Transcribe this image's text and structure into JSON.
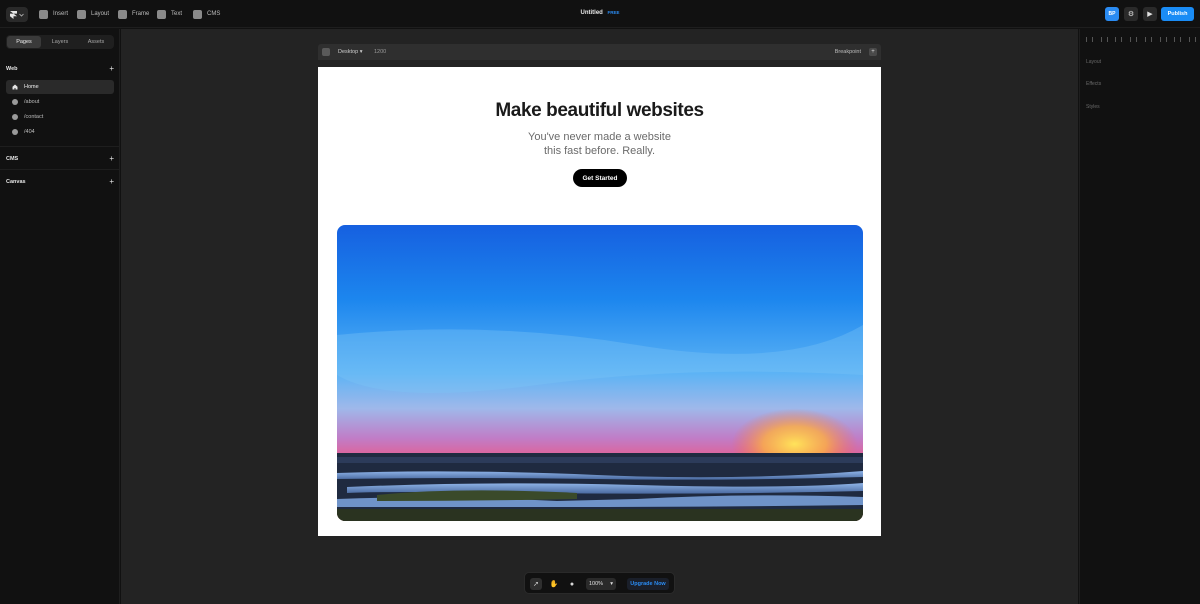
{
  "toolbar": {
    "insert": "Insert",
    "layout": "Layout",
    "frame": "Frame",
    "text": "Text",
    "cms": "CMS",
    "project_title": "Untitled",
    "plan_badge": "FREE",
    "avatar_initials": "BP",
    "publish": "Publish"
  },
  "sidebar": {
    "tabs": [
      "Pages",
      "Layers",
      "Assets"
    ],
    "active_tab": "Pages",
    "web_section": "Web",
    "pages": [
      {
        "label": "Home",
        "active": true
      },
      {
        "label": "/about",
        "active": false
      },
      {
        "label": "/contact",
        "active": false
      },
      {
        "label": "/404",
        "active": false
      }
    ],
    "cms_section": "CMS",
    "canvas_section": "Canvas"
  },
  "canvas": {
    "frame_device": "Desktop",
    "frame_width": "1200",
    "breakpoint_label": "Breakpoint",
    "hero_title": "Make beautiful websites",
    "hero_subtitle_line1": "You've never made a website",
    "hero_subtitle_line2": "this fast before. Really.",
    "cta_label": "Get Started"
  },
  "bottom_toolbar": {
    "zoom": "100%",
    "upgrade": "Upgrade Now"
  },
  "right_panel": {
    "layout": "Layout",
    "effects": "Effects",
    "styles": "Styles"
  },
  "colors": {
    "accent": "#1a8cf5",
    "canvas_bg": "#232323",
    "panel_bg": "#111111"
  }
}
